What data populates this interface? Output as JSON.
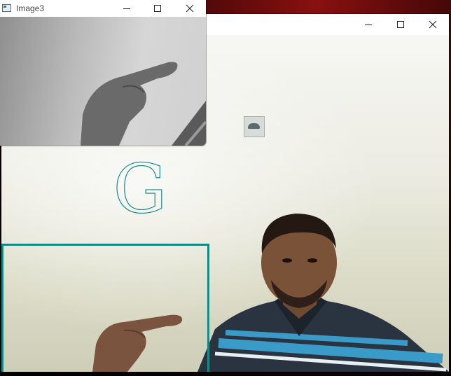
{
  "small_window": {
    "title": "Image3",
    "controls": [
      "minimize-icon",
      "maximize-icon",
      "close-icon"
    ]
  },
  "main_window": {
    "title": "",
    "controls": [
      "minimize-icon",
      "maximize-icon",
      "close-icon"
    ],
    "predicted_letter": "G",
    "roi_color": "#138a86",
    "letter_color": "#1a8a8a"
  }
}
